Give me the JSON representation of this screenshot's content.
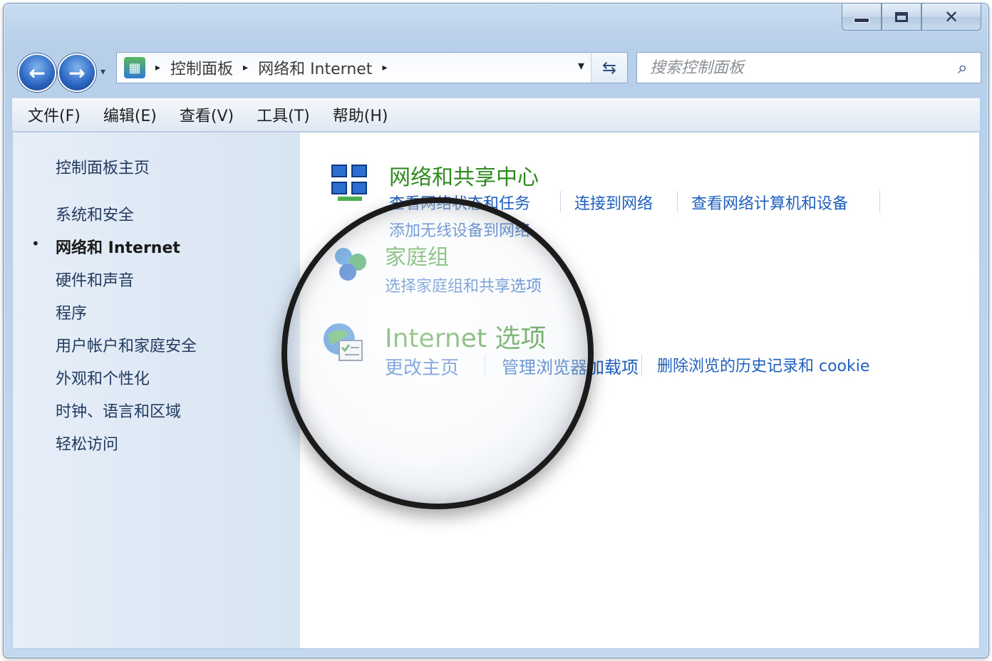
{
  "window": {
    "caption_buttons": {
      "minimize": "—",
      "maximize": "▢",
      "close": "✕"
    }
  },
  "nav": {
    "back_glyph": "←",
    "forward_glyph": "→",
    "history_dropdown": "▾",
    "address_icon": "control-panel-icon",
    "breadcrumb": [
      "控制面板",
      "网络和 Internet"
    ],
    "breadcrumb_sep": "▸",
    "address_dropdown": "▾",
    "refresh_glyph": "⇆"
  },
  "search": {
    "placeholder": "搜索控制面板",
    "icon": "⌕"
  },
  "menu": [
    "文件(F)",
    "编辑(E)",
    "查看(V)",
    "工具(T)",
    "帮助(H)"
  ],
  "sidebar": {
    "home": "控制面板主页",
    "items": [
      "系统和安全",
      "网络和 Internet",
      "硬件和声音",
      "程序",
      "用户帐户和家庭安全",
      "外观和个性化",
      "时钟、语言和区域",
      "轻松访问"
    ],
    "active_index": 1,
    "bullet": "•"
  },
  "categories": {
    "network": {
      "title": "网络和共享中心",
      "links": [
        "查看网络状态和任务",
        "连接到网络",
        "查看网络计算机和设备",
        "添加无线设备到网络"
      ]
    },
    "homegroup": {
      "title": "家庭组",
      "links": [
        "选择家庭组和共享选项"
      ]
    },
    "internet": {
      "title": "Internet 选项",
      "links": [
        "更改主页",
        "管理浏览器加载项",
        "删除浏览的历史记录和 cookie"
      ]
    }
  },
  "colors": {
    "link": "#1e5fbf",
    "category_title": "#2f8a1f",
    "frame": "#b7cfe9"
  }
}
